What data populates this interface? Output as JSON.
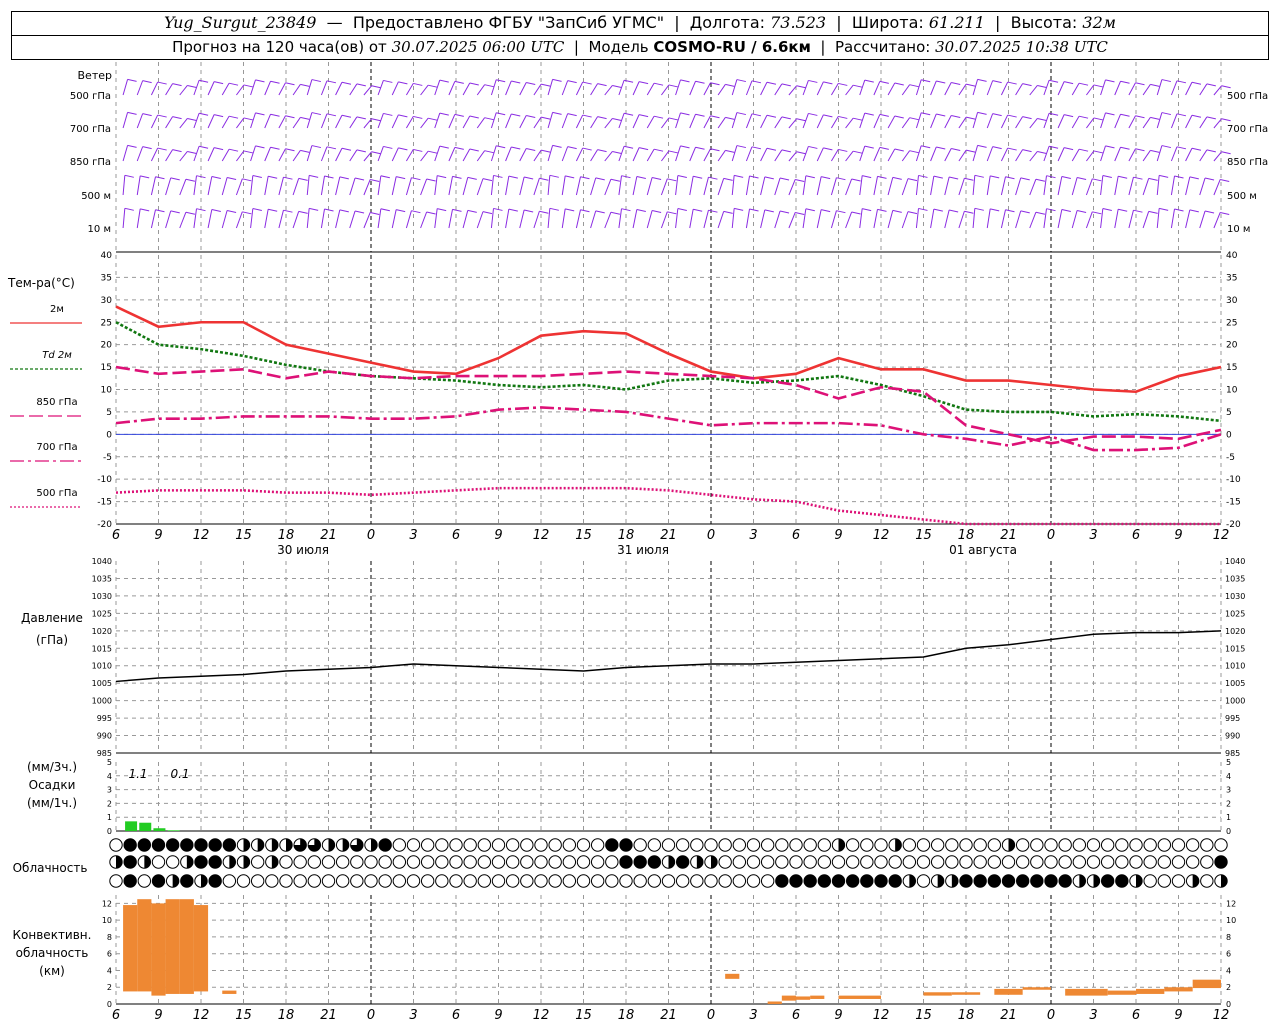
{
  "header": {
    "station": "Yug_Surgut_23849",
    "provider": "Предоставлено ФГБУ \"ЗапСиб УГМС\"",
    "lon_label": "Долгота:",
    "lon": "73.523",
    "lat_label": "Широта:",
    "lat": "61.211",
    "alt_label": "Высота:",
    "alt": "32м",
    "forecast_label": "Прогноз на 120 часа(ов) от",
    "forecast_time": "30.07.2025 06:00 UTC",
    "model_label": "Модель",
    "model": "COSMO-RU / 6.6км",
    "calc_label": "Рассчитано:",
    "calc_time": "30.07.2025 10:38 UTC"
  },
  "axis": {
    "hours": [
      "6",
      "9",
      "12",
      "15",
      "18",
      "21",
      "0",
      "3",
      "6",
      "9",
      "12",
      "15",
      "18",
      "21",
      "0",
      "3",
      "6",
      "9",
      "12",
      "15",
      "18",
      "21",
      "0",
      "3",
      "6",
      "9",
      "12"
    ],
    "dates": [
      "30 июля",
      "31 июля",
      "01 августа"
    ]
  },
  "wind": {
    "title": "Ветер",
    "levels": [
      "500 гПа",
      "700 гПа",
      "850 гПа",
      "500 м",
      "10 м"
    ],
    "color": "#8a2be2"
  },
  "chart_data": [
    {
      "type": "line",
      "title": "Тем-ра(°C)",
      "ylim": [
        -20,
        40
      ],
      "x_hours": [
        0,
        3,
        6,
        9,
        12,
        15,
        18,
        21,
        24,
        27,
        30,
        33,
        36,
        39,
        42,
        45,
        48,
        51,
        54,
        57,
        60,
        63,
        66,
        69,
        72,
        75,
        78
      ],
      "series": [
        {
          "name": "2м",
          "color": "#ee3333",
          "style": "solid",
          "values": [
            28.5,
            24,
            25,
            25,
            20,
            18,
            16,
            14,
            13.5,
            17,
            22,
            23,
            22.5,
            18,
            14,
            12.5,
            13.5,
            17,
            14.5,
            14.5,
            12,
            12,
            11,
            10,
            9.5,
            13,
            15
          ]
        },
        {
          "name": "Td 2м",
          "color": "#117711",
          "style": "dotted",
          "values": [
            25,
            20,
            19,
            17.5,
            15.5,
            14,
            13,
            12.5,
            12,
            11,
            10.5,
            11,
            10,
            12,
            12.5,
            11.5,
            12,
            13,
            11,
            8.5,
            5.5,
            5,
            5,
            4,
            4.5,
            4,
            3
          ]
        },
        {
          "name": "850 гПа",
          "color": "#dd1177",
          "style": "dashed",
          "values": [
            15,
            13.5,
            14,
            14.5,
            12.5,
            14,
            13,
            12.5,
            13,
            13,
            13,
            13.5,
            14,
            13.5,
            13,
            12.5,
            11,
            8,
            10.5,
            9.5,
            2,
            0,
            -2,
            -0.5,
            -0.5,
            -1,
            1
          ]
        },
        {
          "name": "700 гПа",
          "color": "#dd1177",
          "style": "dashdot",
          "values": [
            2.5,
            3.5,
            3.5,
            4,
            4,
            4,
            3.5,
            3.5,
            4,
            5.5,
            6,
            5.5,
            5,
            3.5,
            2,
            2.5,
            2.5,
            2.5,
            2,
            0,
            -1,
            -2.5,
            -0.5,
            -3.5,
            -3.5,
            -3,
            0
          ]
        },
        {
          "name": "500 гПа",
          "color": "#dd1177",
          "style": "densedot",
          "values": [
            -13,
            -12.5,
            -12.5,
            -12.5,
            -13,
            -13,
            -13.5,
            -13,
            -12.5,
            -12,
            -12,
            -12,
            -12,
            -12.5,
            -13.5,
            -14.5,
            -15,
            -17,
            -18,
            -19,
            -20,
            -20,
            -20,
            -20,
            -20,
            -20,
            -20
          ]
        }
      ]
    },
    {
      "type": "line",
      "title": "Давление (гПа)",
      "ylim": [
        985,
        1040
      ],
      "x_hours": [
        0,
        3,
        6,
        9,
        12,
        15,
        18,
        21,
        24,
        27,
        30,
        33,
        36,
        39,
        42,
        45,
        48,
        51,
        54,
        57,
        60,
        63,
        66,
        69,
        72,
        75,
        78
      ],
      "series": [
        {
          "name": "",
          "color": "#000000",
          "values": [
            1005.5,
            1006.5,
            1007,
            1007.5,
            1008.5,
            1009,
            1009.5,
            1010.5,
            1010,
            1009.5,
            1009,
            1008.5,
            1009.5,
            1010,
            1010.5,
            1010.5,
            1011,
            1011.5,
            1012,
            1012.5,
            1015,
            1016,
            1017.5,
            1019,
            1019.5,
            1019.5,
            1020
          ]
        }
      ]
    },
    {
      "type": "bar",
      "title": "Осадки (мм/3ч.) (мм/1ч.)",
      "ylim": [
        0,
        5
      ],
      "annotations": [
        "1.1",
        "0.1"
      ],
      "x_hours": [
        1,
        2,
        3,
        4
      ],
      "values": [
        0.7,
        0.6,
        0.2,
        0.05
      ]
    },
    {
      "type": "bar",
      "title": "Конвективн. облачность (км)",
      "ylim": [
        0,
        13
      ],
      "bars": [
        {
          "x0": 0.5,
          "x1": 1.5,
          "bottom": 1.5,
          "top": 11.8
        },
        {
          "x0": 1.5,
          "x1": 2.5,
          "bottom": 1.5,
          "top": 12.5
        },
        {
          "x0": 2.5,
          "x1": 3.5,
          "bottom": 1,
          "top": 12
        },
        {
          "x0": 3.5,
          "x1": 4.5,
          "bottom": 1.2,
          "top": 12.5
        },
        {
          "x0": 4.5,
          "x1": 5.5,
          "bottom": 1.2,
          "top": 12.5
        },
        {
          "x0": 5.5,
          "x1": 6.5,
          "bottom": 1.5,
          "top": 11.8
        },
        {
          "x0": 7.5,
          "x1": 8.5,
          "bottom": 1.2,
          "top": 1.6
        },
        {
          "x0": 43,
          "x1": 44,
          "bottom": 3,
          "top": 3.6
        },
        {
          "x0": 46,
          "x1": 47,
          "bottom": 0,
          "top": 0.3
        },
        {
          "x0": 47,
          "x1": 48,
          "bottom": 0.4,
          "top": 1
        },
        {
          "x0": 48,
          "x1": 49,
          "bottom": 0.5,
          "top": 0.9
        },
        {
          "x0": 49,
          "x1": 50,
          "bottom": 0.6,
          "top": 1
        },
        {
          "x0": 51,
          "x1": 54,
          "bottom": 0.6,
          "top": 1
        },
        {
          "x0": 57,
          "x1": 59,
          "bottom": 1,
          "top": 1.4
        },
        {
          "x0": 59,
          "x1": 61,
          "bottom": 1.1,
          "top": 1.4
        },
        {
          "x0": 62,
          "x1": 64,
          "bottom": 1.1,
          "top": 1.8
        },
        {
          "x0": 64,
          "x1": 66,
          "bottom": 1.7,
          "top": 2
        },
        {
          "x0": 67,
          "x1": 70,
          "bottom": 1,
          "top": 1.8
        },
        {
          "x0": 70,
          "x1": 72,
          "bottom": 1.1,
          "top": 1.6
        },
        {
          "x0": 72,
          "x1": 74,
          "bottom": 1.2,
          "top": 1.8
        },
        {
          "x0": 74,
          "x1": 76,
          "bottom": 1.5,
          "top": 2
        },
        {
          "x0": 76,
          "x1": 78,
          "bottom": 1.9,
          "top": 2.9
        }
      ]
    }
  ],
  "temp_legend": {
    "title": "Тем-ра(°C)",
    "items": [
      "2м",
      "Td 2м",
      "850 гПа",
      "700 гПа",
      "500 гПа"
    ]
  },
  "pressure_label": [
    "Давление",
    "(гПа)"
  ],
  "precip_label": [
    "(мм/3ч.)",
    "Осадки",
    "(мм/1ч.)"
  ],
  "precip_annotations": [
    "1.1",
    "0.1"
  ],
  "cloud_label": "Облачность",
  "conv_label": [
    "Конвективн.",
    "облачность",
    "(км)"
  ],
  "colors": {
    "green_bar": "#22cc22",
    "orange_bar": "#ee8833",
    "grid": "#999999"
  }
}
